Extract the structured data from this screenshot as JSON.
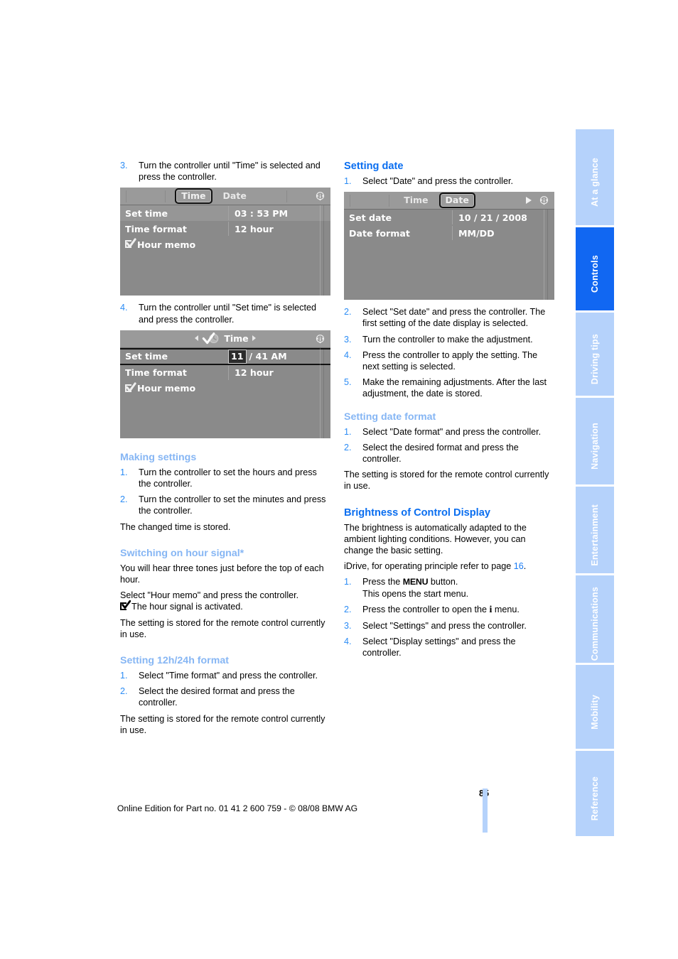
{
  "page": {
    "number": "85",
    "footer": "Online Edition for Part no. 01 41 2 600 759 - © 08/08 BMW AG"
  },
  "tabs": [
    {
      "label": "At a glance",
      "active": false
    },
    {
      "label": "Controls",
      "active": true
    },
    {
      "label": "Driving tips",
      "active": false
    },
    {
      "label": "Navigation",
      "active": false
    },
    {
      "label": "Entertainment",
      "active": false
    },
    {
      "label": "Communications",
      "active": false
    },
    {
      "label": "Mobility",
      "active": false
    },
    {
      "label": "Reference",
      "active": false
    }
  ],
  "colors": {
    "accent_blue": "#1167f2",
    "tab_inactive": "#b5d2fb",
    "subheading_blue": "#86b6f4",
    "heading_blue": "#0a6ef0",
    "step_number_blue": "#2b8cf5"
  },
  "left_column": {
    "step3": {
      "num": "3.",
      "text": "Turn the controller until \"Time\" is selected and press the controller."
    },
    "shot_time": {
      "tab_time": "Time",
      "tab_date": "Date",
      "rows": [
        {
          "label": "Set time",
          "value": "03 : 53 PM"
        },
        {
          "label": "Time format",
          "value": "12 hour"
        },
        {
          "label": "Hour memo",
          "value": ""
        }
      ]
    },
    "step4": {
      "num": "4.",
      "text": "Turn the controller until \"Set time\" is selected and press the controller."
    },
    "shot_settime": {
      "title": "Time",
      "rows": [
        {
          "label": "Set time",
          "value_selected": "11",
          "value_rest": "/ 41 AM"
        },
        {
          "label": "Time format",
          "value": "12 hour"
        },
        {
          "label": "Hour memo",
          "value": ""
        }
      ]
    },
    "making_settings": {
      "heading": "Making settings",
      "steps": [
        {
          "num": "1.",
          "text": "Turn the controller to set the hours and press the controller."
        },
        {
          "num": "2.",
          "text": "Turn the controller to set the minutes and press the controller."
        }
      ],
      "note": "The changed time is stored."
    },
    "hour_signal": {
      "heading": "Switching on hour signal*",
      "para1": "You will hear three tones just before the top of each hour.",
      "para2": "Select \"Hour memo\" and press the controller.",
      "para3": "The hour signal is activated.",
      "para4": "The setting is stored for the remote control currently in use."
    },
    "format_1224": {
      "heading": "Setting 12h/24h format",
      "steps": [
        {
          "num": "1.",
          "text": "Select \"Time format\" and press the controller."
        },
        {
          "num": "2.",
          "text": "Select the desired format and press the controller."
        }
      ],
      "note": "The setting is stored for the remote control currently in use."
    }
  },
  "right_column": {
    "setting_date": {
      "heading": "Setting date",
      "step1": {
        "num": "1.",
        "text": "Select \"Date\" and press the controller."
      },
      "shot_date": {
        "tab_time": "Time",
        "tab_date": "Date",
        "rows": [
          {
            "label": "Set date",
            "value": "10 / 21 / 2008"
          },
          {
            "label": "Date format",
            "value": "MM/DD"
          }
        ]
      },
      "steps": [
        {
          "num": "2.",
          "text": "Select \"Set date\" and press the controller. The first setting of the date display is selected."
        },
        {
          "num": "3.",
          "text": "Turn the controller to make the adjustment."
        },
        {
          "num": "4.",
          "text": "Press the controller to apply the setting. The next setting is selected."
        },
        {
          "num": "5.",
          "text": "Make the remaining adjustments. After the last adjustment, the date is stored."
        }
      ]
    },
    "setting_date_format": {
      "heading": "Setting date format",
      "steps": [
        {
          "num": "1.",
          "text": "Select \"Date format\" and press the controller."
        },
        {
          "num": "2.",
          "text": "Select the desired format and press the controller."
        }
      ],
      "note": "The setting is stored for the remote control currently in use."
    },
    "brightness": {
      "heading": "Brightness of Control Display",
      "para1": "The brightness is automatically adapted to the ambient lighting conditions. However, you can change the basic setting.",
      "idrive_pre": "iDrive, for operating principle refer to page ",
      "idrive_page": "16",
      "idrive_post": ".",
      "steps": [
        {
          "num": "1.",
          "pre": "Press the ",
          "key": "MENU",
          "post": " button.",
          "second_line": "This opens the start menu."
        },
        {
          "num": "2.",
          "pre": "Press the controller to open the ",
          "key": "i",
          "post": " menu."
        },
        {
          "num": "3.",
          "text": "Select \"Settings\" and press the controller."
        },
        {
          "num": "4.",
          "text": "Select \"Display settings\" and press the controller."
        }
      ]
    }
  }
}
